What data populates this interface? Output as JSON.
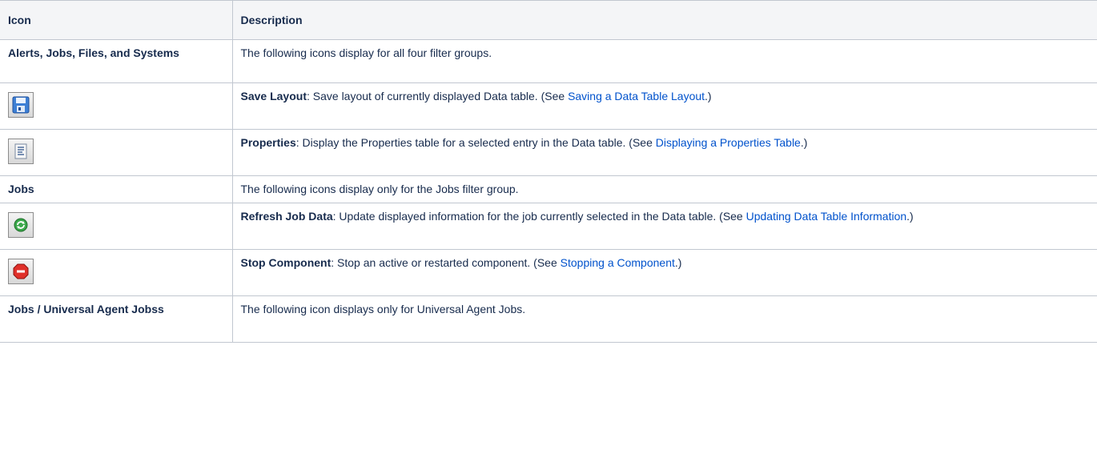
{
  "table": {
    "headers": {
      "icon": "Icon",
      "description": "Description"
    },
    "rows": [
      {
        "type": "group",
        "label": "Alerts, Jobs, Files, and Systems",
        "text": "The following icons display for all four filter groups."
      },
      {
        "type": "icon",
        "icon": "save-layout-icon",
        "term": "Save Layout",
        "pre": ": Save layout of currently displayed Data table. (See ",
        "link": "Saving a Data Table Layout",
        "post": ".)"
      },
      {
        "type": "icon",
        "icon": "properties-icon",
        "term": "Properties",
        "pre": ": Display the Properties table for a selected entry in the Data table. (See ",
        "link": "Displaying a Properties Table",
        "post": ".)"
      },
      {
        "type": "group",
        "label": "Jobs",
        "text": "The following icons display only for the Jobs filter group."
      },
      {
        "type": "icon",
        "icon": "refresh-job-data-icon",
        "term": "Refresh Job Data",
        "pre": ": Update displayed information for the job currently selected in the Data table. (See ",
        "link": "Updating Data Table Information",
        "post": ".)"
      },
      {
        "type": "icon",
        "icon": "stop-component-icon",
        "term": "Stop Component",
        "pre": ": Stop an active or restarted component. (See ",
        "link": "Stopping a Component",
        "post": ".)"
      },
      {
        "type": "group",
        "label": "Jobs / Universal Agent Jobss",
        "text": "The following icon displays only for Universal Agent Jobs."
      }
    ]
  },
  "colors": {
    "link": "#0052cc",
    "header_bg": "#f4f5f7",
    "border": "#c1c7d0",
    "text": "#172b4d"
  }
}
